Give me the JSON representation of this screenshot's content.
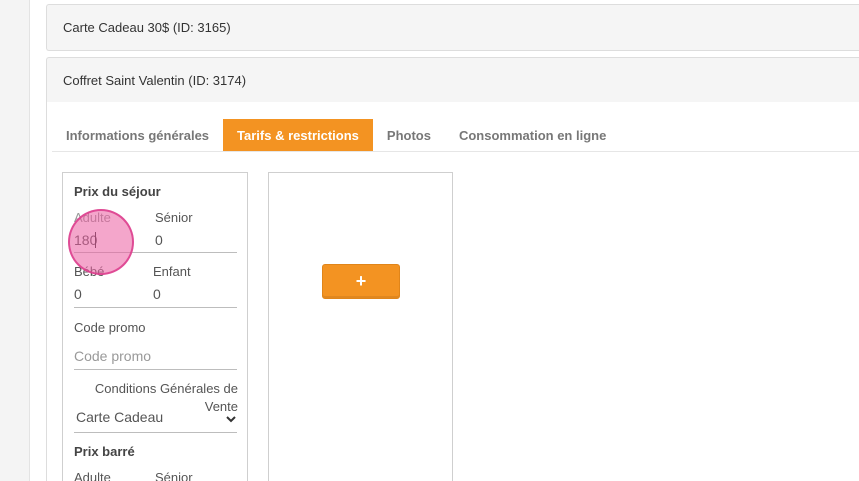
{
  "panels": [
    {
      "title": "Carte Cadeau 30$ (ID: 3165)"
    },
    {
      "title": "Coffret Saint Valentin (ID: 3174)"
    }
  ],
  "tabs": [
    {
      "label": "Informations générales",
      "active": false
    },
    {
      "label": "Tarifs & restrictions",
      "active": true
    },
    {
      "label": "Photos",
      "active": false
    },
    {
      "label": "Consommation en ligne",
      "active": false
    }
  ],
  "prix_sejour": {
    "title": "Prix du séjour",
    "adulte_label": "Adulte",
    "adulte_value": "180",
    "senior_label": "Sénior",
    "senior_value": "0",
    "bebe_label": "Bébé",
    "bebe_value": "0",
    "enfant_label": "Enfant",
    "enfant_value": "0"
  },
  "code_promo": {
    "label": "Code promo",
    "placeholder": "Code promo"
  },
  "cgv": {
    "label": "Conditions Générales de Vente",
    "selected": "Carte Cadeau"
  },
  "prix_barre": {
    "title": "Prix barré",
    "adulte_label": "Adulte",
    "senior_label": "Sénior"
  },
  "add_button": {
    "label": "+"
  },
  "colors": {
    "accent": "#f39322",
    "click_marker": "#eb5ca0"
  },
  "icons": {
    "select_arrow": "chevron-down-icon"
  }
}
